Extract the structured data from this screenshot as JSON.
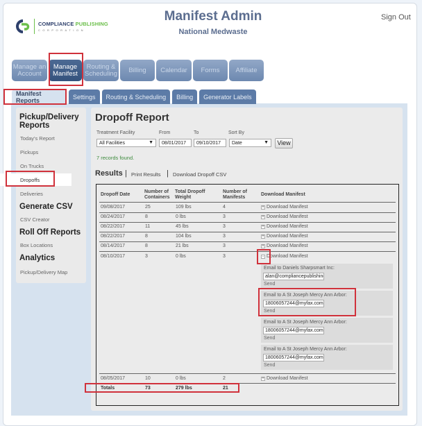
{
  "header": {
    "logo": {
      "icon": "compliance-publishing-logo-icon",
      "name_part1": "COMPLIANCE ",
      "name_part2": "PUBLISHING",
      "tagline": "CORPORATION"
    },
    "title": "Manifest Admin",
    "subtitle": "National Medwaste",
    "sign_out": "Sign Out"
  },
  "main_nav": [
    {
      "label": "Manage an Account",
      "active": false
    },
    {
      "label": "Manage Manifest",
      "active": true
    },
    {
      "label": "Routing & Scheduling",
      "active": false
    },
    {
      "label": "Billing",
      "active": false
    },
    {
      "label": "Calendar",
      "active": false
    },
    {
      "label": "Forms",
      "active": false
    },
    {
      "label": "Affiliate",
      "active": false
    }
  ],
  "sub_tabs": [
    {
      "label": "Manifest Reports",
      "active": true
    },
    {
      "label": "Settings",
      "active": false
    },
    {
      "label": "Routing & Scheduling",
      "active": false
    },
    {
      "label": "Billing",
      "active": false
    },
    {
      "label": "Generator Labels",
      "active": false
    }
  ],
  "sidebar": {
    "sections": [
      {
        "heading": "Pickup/Delivery Reports",
        "items": [
          "Today's Report",
          "Pickups",
          "On Trucks",
          "Dropoffs",
          "Deliveries"
        ]
      },
      {
        "heading": "Generate CSV",
        "items": [
          "CSV Creator"
        ]
      },
      {
        "heading": "Roll Off Reports",
        "items": [
          "Box Locations"
        ]
      },
      {
        "heading": "Analytics",
        "items": [
          "Pickup/Delivery Map"
        ]
      }
    ],
    "active_item": "Dropoffs"
  },
  "report": {
    "title": "Dropoff Report",
    "filters": {
      "facility_label": "Treatment Facility",
      "facility_value": "All Facilities",
      "from_label": "From",
      "from_value": "08/01/2017",
      "to_label": "To",
      "to_value": "09/10/2017",
      "sort_label": "Sort By",
      "sort_value": "Date",
      "view_button": "View"
    },
    "records_found": "7 records found.",
    "results_heading": "Results",
    "separator": "|",
    "print_link": "Print Results",
    "csv_link": "Download Dropoff CSV",
    "table": {
      "headers": [
        "Dropoff Date",
        "Number of Containers",
        "Total Dropoff Weight",
        "Number of Manifests",
        "Download Manifest"
      ],
      "rows": [
        {
          "date": "09/08/2017",
          "containers": "25",
          "weight": "109 lbs",
          "manifests": "4",
          "toggle": "+",
          "link": "Download Manifest"
        },
        {
          "date": "08/24/2017",
          "containers": "8",
          "weight": "0 lbs",
          "manifests": "3",
          "toggle": "+",
          "link": "Download Manifest"
        },
        {
          "date": "08/22/2017",
          "containers": "11",
          "weight": "45 lbs",
          "manifests": "3",
          "toggle": "+",
          "link": "Download Manifest"
        },
        {
          "date": "08/22/2017",
          "containers": "8",
          "weight": "104 lbs",
          "manifests": "3",
          "toggle": "+",
          "link": "Download Manifest"
        },
        {
          "date": "08/14/2017",
          "containers": "8",
          "weight": "21 lbs",
          "manifests": "3",
          "toggle": "+",
          "link": "Download Manifest"
        },
        {
          "date": "08/10/2017",
          "containers": "3",
          "weight": "0 lbs",
          "manifests": "3",
          "toggle": "-",
          "link": "Download Manifest"
        },
        {
          "date": "08/05/2017",
          "containers": "10",
          "weight": "0 lbs",
          "manifests": "2",
          "toggle": "+",
          "link": "Download Manifest"
        }
      ],
      "expanded_emails": [
        {
          "label": "Email to Daniels Sharpsmart Inc:",
          "value": "alan@compliancepublishing",
          "send": "Send"
        },
        {
          "label": "Email to A St Joseph Mercy Ann Arbor:",
          "value": "18006057244@myfax.com",
          "send": "Send"
        },
        {
          "label": "Email to A St Joseph Mercy Ann Arbor:",
          "value": "18006057244@myfax.com",
          "send": "Send"
        },
        {
          "label": "Email to A St Joseph Mercy Ann Arbor:",
          "value": "18006057244@myfax.com",
          "send": "Send"
        }
      ],
      "totals": {
        "label": "Totals",
        "containers": "73",
        "weight": "279 lbs",
        "manifests": "21"
      }
    }
  },
  "colors": {
    "nav_active": "#34527c",
    "nav": "#7a93b8",
    "subtab": "#5c7ba7",
    "highlight": "#d0313b",
    "records_text": "#3d8b3d"
  }
}
